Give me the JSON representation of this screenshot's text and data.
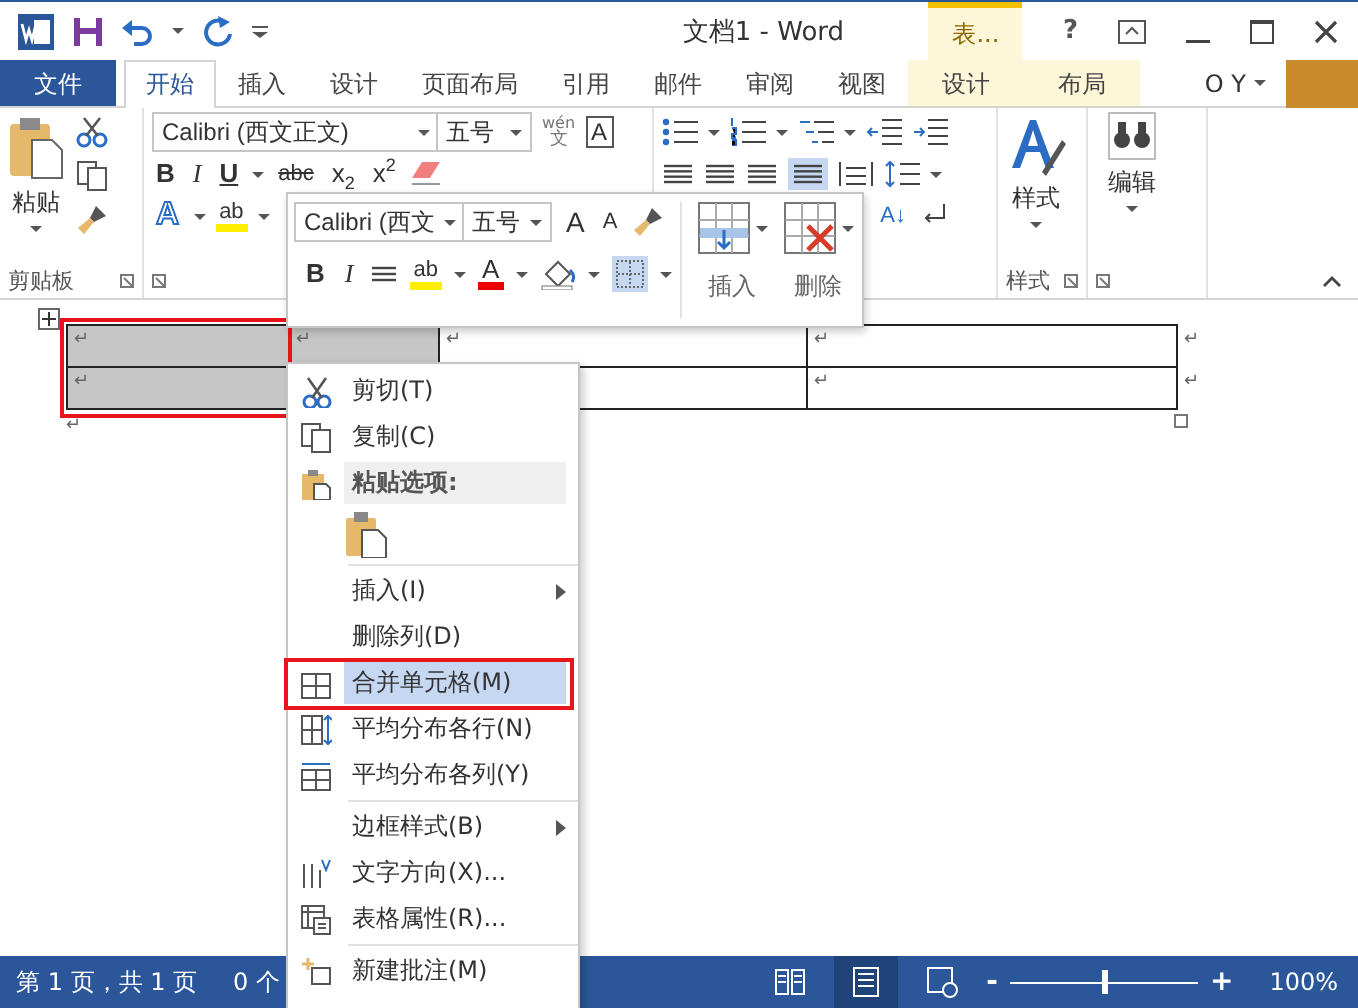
{
  "title_bar": {
    "title": "文档1 - Word",
    "context_group": "表...",
    "help": "?"
  },
  "tabs": [
    {
      "label": "文件",
      "kind": "file",
      "selected": false
    },
    {
      "label": "开始",
      "kind": "normal",
      "selected": true
    },
    {
      "label": "插入",
      "kind": "normal",
      "selected": false
    },
    {
      "label": "设计",
      "kind": "normal",
      "selected": false
    },
    {
      "label": "页面布局",
      "kind": "normal",
      "selected": false
    },
    {
      "label": "引用",
      "kind": "normal",
      "selected": false
    },
    {
      "label": "邮件",
      "kind": "normal",
      "selected": false
    },
    {
      "label": "审阅",
      "kind": "normal",
      "selected": false
    },
    {
      "label": "视图",
      "kind": "normal",
      "selected": false
    },
    {
      "label": "设计",
      "kind": "context",
      "selected": false
    },
    {
      "label": "布局",
      "kind": "context",
      "selected": false
    }
  ],
  "user": "O Y",
  "ribbon": {
    "clipboard": {
      "paste": "粘贴",
      "label": "剪贴板"
    },
    "font": {
      "font_name": "Calibri (西文正文)",
      "font_size": "五号",
      "phonetic": "wén",
      "phonetic_char": "文",
      "char_border": "A",
      "bold": "B",
      "italic": "I",
      "underline": "U",
      "strike": "abc",
      "subscript": "x$_{2}$",
      "superscript": "x$^{2}$",
      "effects": "A",
      "highlight": "ab"
    },
    "paragraph": {
      "sort": "A↓"
    },
    "styles": {
      "button": "样式",
      "label": "样式"
    },
    "editing": {
      "button": "编辑"
    }
  },
  "mini_toolbar": {
    "font_name": "Calibri (西文",
    "font_size": "五号",
    "grow": "A",
    "shrink": "A",
    "bold": "B",
    "italic": "I",
    "highlight": "ab",
    "font_color": "A",
    "insert": "插入",
    "delete": "删除"
  },
  "table": {
    "callout": true,
    "rows": [
      {
        "cells": [
          {
            "text": "↵",
            "selected": true
          },
          {
            "text": "↵",
            "selected": true
          },
          {
            "text": "↵",
            "selected": false
          },
          {
            "text": "↵",
            "selected": false
          }
        ],
        "end": "↵"
      },
      {
        "cells": [
          {
            "text": "↵",
            "selected": true
          },
          null,
          null,
          {
            "text": "↵",
            "selected": false
          }
        ],
        "end": "↵"
      }
    ],
    "after": "↵"
  },
  "context_menu": {
    "items": [
      {
        "kind": "command",
        "label": "剪切(T)",
        "selected": false
      },
      {
        "kind": "command",
        "label": "复制(C)",
        "selected": false
      },
      {
        "kind": "header",
        "label": "粘贴选项:"
      },
      {
        "kind": "paste_option"
      },
      {
        "kind": "separator"
      },
      {
        "kind": "submenu",
        "label": "插入(I)",
        "selected": false
      },
      {
        "kind": "command",
        "label": "删除列(D)",
        "selected": false
      },
      {
        "kind": "command",
        "label": "合并单元格(M)",
        "selected": true,
        "callout": true
      },
      {
        "kind": "command",
        "label": "平均分布各行(N)",
        "selected": false
      },
      {
        "kind": "command",
        "label": "平均分布各列(Y)",
        "selected": false
      },
      {
        "kind": "separator"
      },
      {
        "kind": "submenu",
        "label": "边框样式(B)",
        "selected": false
      },
      {
        "kind": "command",
        "label": "文字方向(X)...",
        "selected": false
      },
      {
        "kind": "command",
        "label": "表格属性(R)...",
        "selected": false
      },
      {
        "kind": "separator"
      },
      {
        "kind": "command",
        "label": "新建批注(M)",
        "selected": false
      }
    ]
  },
  "status_bar": {
    "page": "第 1 页，共 1 页",
    "words": "0 个",
    "views": [
      {
        "selected": false
      },
      {
        "selected": true
      },
      {
        "selected": false
      }
    ],
    "zoom_out": "-",
    "zoom_in": "+",
    "zoom": {
      "level": 0.5
    },
    "zoom_text": "100%"
  }
}
